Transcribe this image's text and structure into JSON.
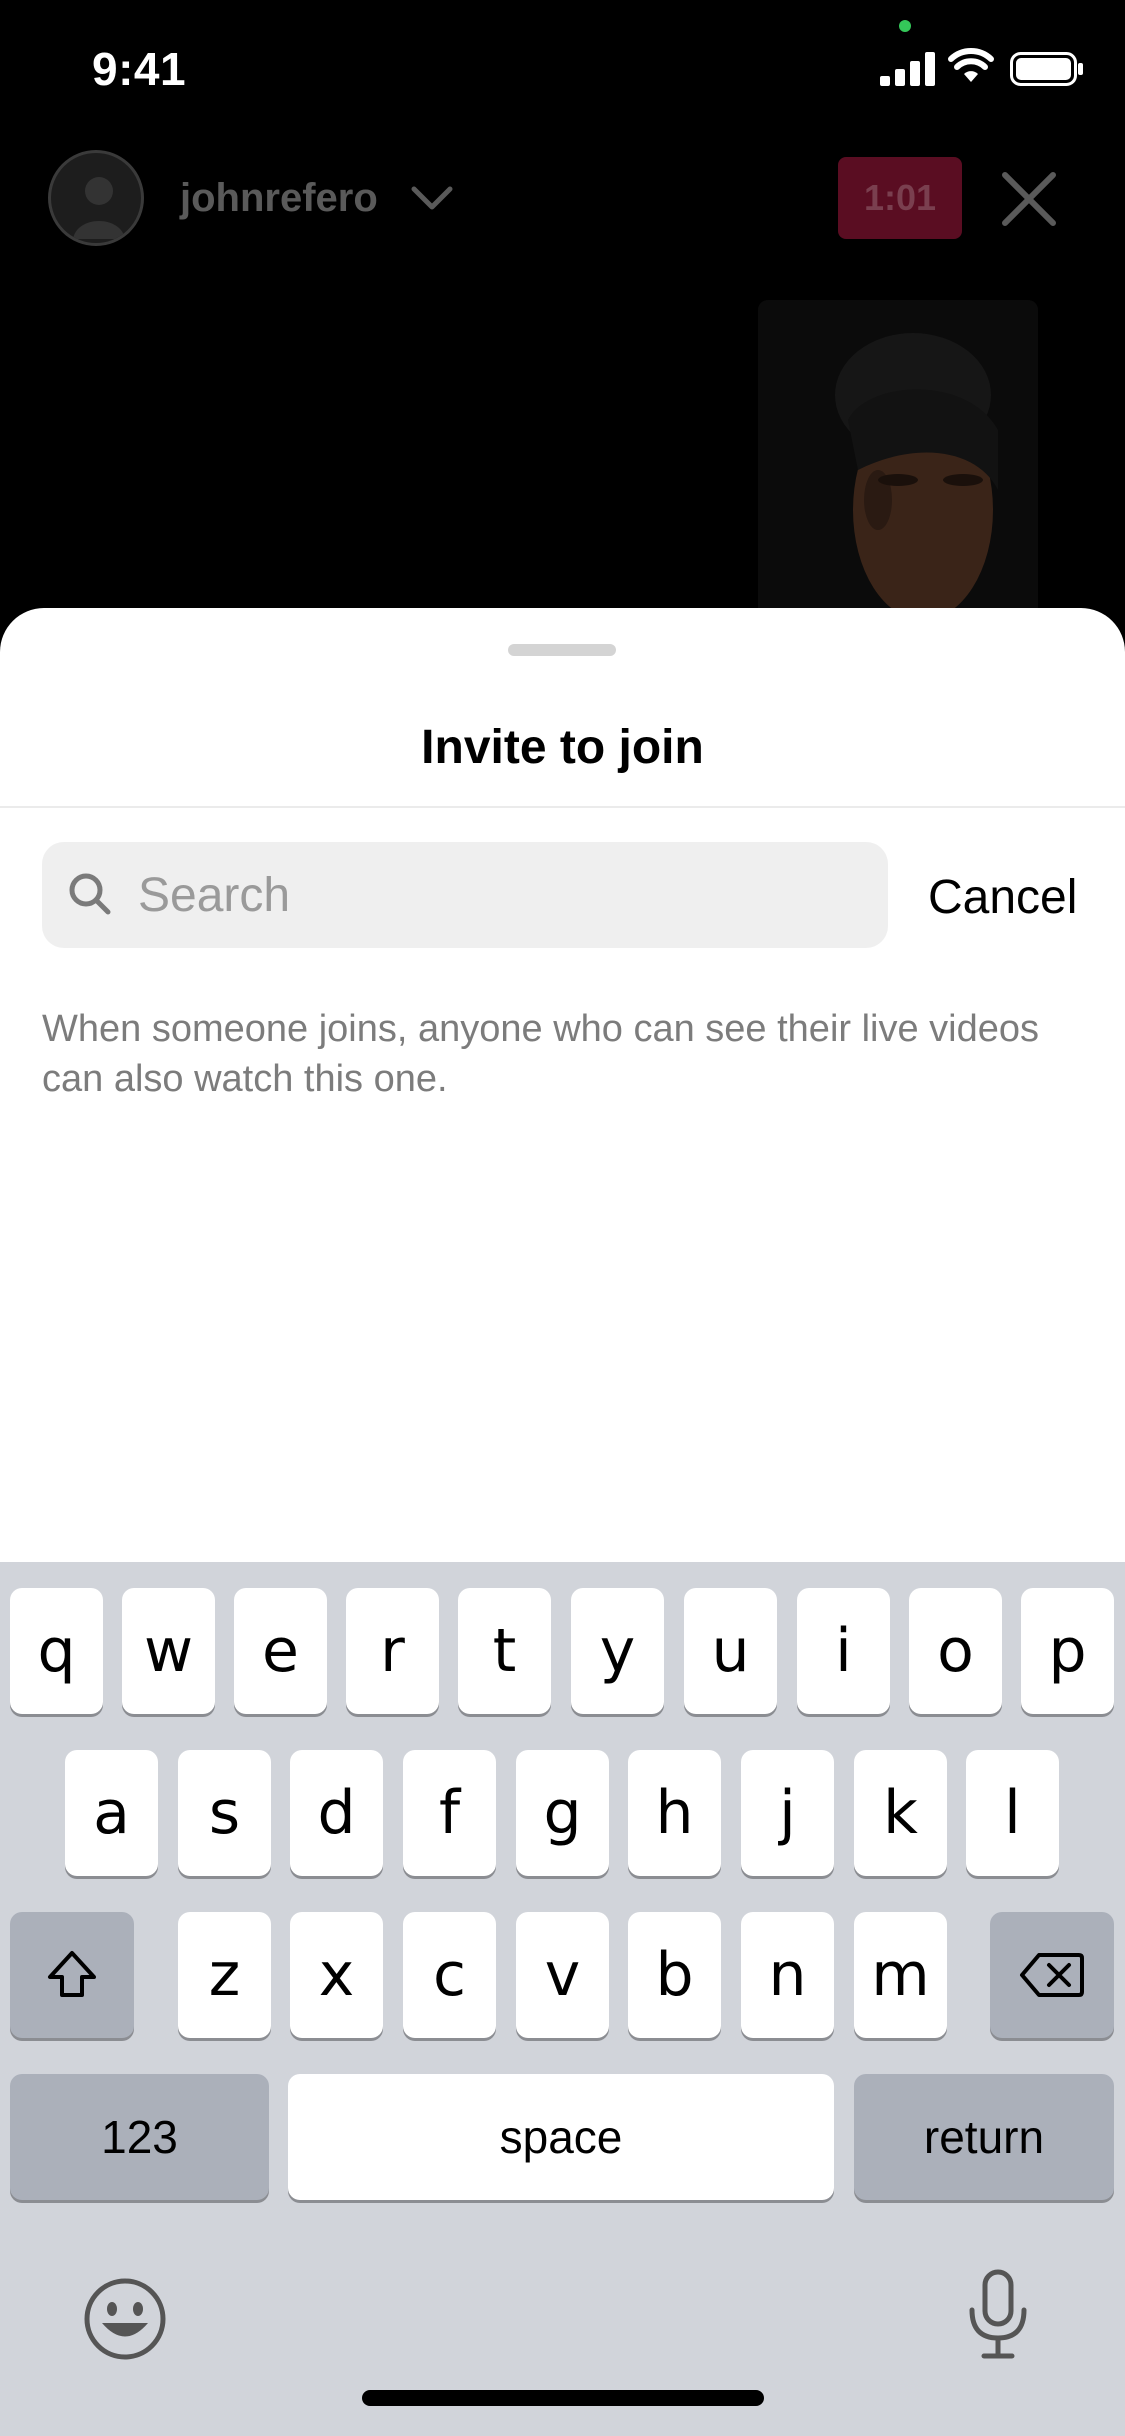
{
  "status_bar": {
    "time": "9:41"
  },
  "live_header": {
    "username": "johnrefero",
    "timer": "1:01"
  },
  "sheet": {
    "title": "Invite to join",
    "search": {
      "placeholder": "Search",
      "value": ""
    },
    "cancel_label": "Cancel",
    "info_text": "When someone joins, anyone who can see their live videos can also watch this one."
  },
  "keyboard": {
    "row1": [
      "q",
      "w",
      "e",
      "r",
      "t",
      "y",
      "u",
      "i",
      "o",
      "p"
    ],
    "row2": [
      "a",
      "s",
      "d",
      "f",
      "g",
      "h",
      "j",
      "k",
      "l"
    ],
    "row3": [
      "z",
      "x",
      "c",
      "v",
      "b",
      "n",
      "m"
    ],
    "numbers_label": "123",
    "space_label": "space",
    "return_label": "return"
  },
  "colors": {
    "accent_live": "#5a0d22",
    "sheet_background": "#ffffff",
    "keyboard_background": "#d1d4da"
  }
}
